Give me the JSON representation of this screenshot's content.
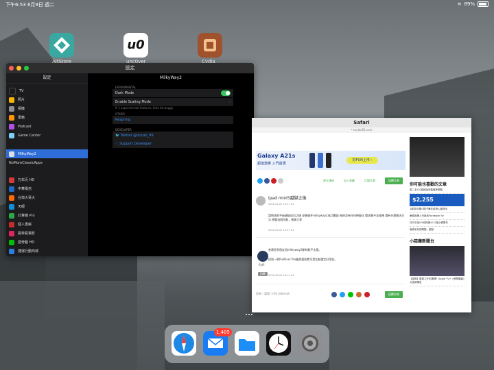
{
  "status_bar": {
    "time_date": "下午6:53   6月9日 週二",
    "battery_percent": "89%"
  },
  "home_icons": [
    {
      "label": "AltStore"
    },
    {
      "label": "unc0ver"
    },
    {
      "label": "Cydia"
    }
  ],
  "settings": {
    "window_title": "設定",
    "sidebar_header": "設定",
    "sidebar_items": [
      {
        "label": "TV",
        "color": "#1c1c1e"
      },
      {
        "label": "照片",
        "color": "#f7b500"
      },
      {
        "label": "相機",
        "color": "#8e8e93"
      },
      {
        "label": "書籍",
        "color": "#ff9500"
      },
      {
        "label": "Podcast",
        "color": "#b450e6"
      },
      {
        "label": "Game Center",
        "color": "#7bd0f5"
      }
    ],
    "selected_item": "MilkyWay2",
    "plain_item": "NoMoreClassicApps",
    "app_items": [
      {
        "label": "万年历 HD",
        "color": "#d53b3b"
      },
      {
        "label": "中華電信",
        "color": "#1f6bc8"
      },
      {
        "label": "台灣大哥大",
        "color": "#ff6a00"
      },
      {
        "label": "天眼",
        "color": "#0f8fd8"
      },
      {
        "label": "計算機 Pro",
        "color": "#2aa748"
      },
      {
        "label": "個人書庫",
        "color": "#c52b2b"
      },
      {
        "label": "開車看電影",
        "color": "#e0245e"
      },
      {
        "label": "愛奇藝 HD",
        "color": "#00be06"
      },
      {
        "label": "捷運行動商城",
        "color": "#2b7de0"
      }
    ],
    "main_title": "MilkyWay2",
    "experimental_header": "EXPERIMENTAL",
    "dark_mode_label": "Dark Mode",
    "dark_mode_on": true,
    "scaling_label": "Enable Scaling Mode",
    "experimental_note": "It´s experimental features, little bit buggy.",
    "other_header": "OTHER",
    "respring_label": "Respring",
    "developer_header": "DEVELOPER",
    "twitter_label": "Twitter @ducati_99",
    "support_label": "Support Developer"
  },
  "safari": {
    "window_title": "Safari",
    "url": "• tuxiao51.com",
    "ad": {
      "headline": "Galaxy A21s",
      "tagline": "超值激推 入門首選",
      "cta": "好FUN上市 ›"
    },
    "action_buttons": [
      "原文連結",
      "加入收藏",
      "訂閱文章"
    ],
    "reply_button": "回覆文章",
    "post_title": "ipad mini5越獄之後",
    "post_meta": "2020-02-22 10:57 #1",
    "post_body": "請問這款平板越獄成功之後 安裝插件milkyway2成功畫面 長按沒有任何視窗化 還這隻不支援嗎 還有什麼解決方法 想要這個功能，感謝大家",
    "post_meta2": "2020-02-22 10:57 #1",
    "reply_body1": "各連很多朋友用milkyway2都有點不太穩。",
    "reply_body2": "找到一款PullOver Pro雖然要收費可是比較穩定好用些。",
    "reply_meta": "2020-06-09 18:14 #2",
    "reply_user": "flyfli",
    "reply_tag": "回覆",
    "footer_breadcrumb": "首頁 › 論壇 › iOS jailbreak",
    "footer_button": "回覆文章",
    "sidebar_head1": "你可能也喜歡的文章",
    "sidebar_links": [
      "萬二手iOS越獄版安裝機會問題",
      "1樓同天擺IG橫子兼年前搞入都提出",
      "華碩官網上市新品Facebook fly",
      "月刊平版iOS保時機卡12搖小蘋果作",
      "維修系列的問題，越獄"
    ],
    "sidebar_price": "$2,255",
    "sidebar_head2": "小惡魔新聞台",
    "news_caption": "【話題】蘋果之外的選擇？Apple TV+《翡翠羅盤》大結局預告"
  },
  "dock": {
    "mail_badge": "1,405",
    "apps": [
      "safari-icon",
      "mail-icon",
      "files-icon",
      "clock-icon",
      "settings-icon"
    ]
  }
}
